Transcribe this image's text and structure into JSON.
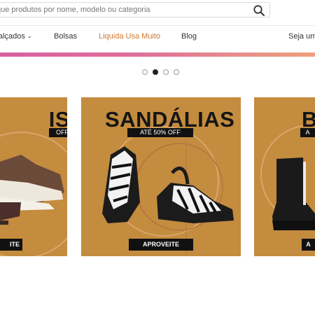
{
  "search": {
    "placeholder": "que produtos por nome, modelo ou categoria",
    "icon": "search-icon"
  },
  "nav": {
    "items": [
      {
        "label": "alçados",
        "has_dropdown": true
      },
      {
        "label": "Bolsas"
      },
      {
        "label": "Liquida Usa Muito",
        "promo": true
      },
      {
        "label": "Blog"
      },
      {
        "label": "Seja um"
      }
    ]
  },
  "colors": {
    "promo": "#d3762a",
    "banner_gradient": [
      "#d561a0",
      "#ef9f7d"
    ],
    "card_bg": "#c48c3f"
  },
  "carousel": {
    "dot_count": 4,
    "active_index": 1
  },
  "cards": [
    {
      "title": "IS",
      "badge": "OFF",
      "button": "ITE"
    },
    {
      "title": "SANDÁLIAS",
      "badge": "ATÉ 50% OFF",
      "button": "APROVEITE"
    },
    {
      "title": "B",
      "badge": "A",
      "button": "A"
    }
  ]
}
